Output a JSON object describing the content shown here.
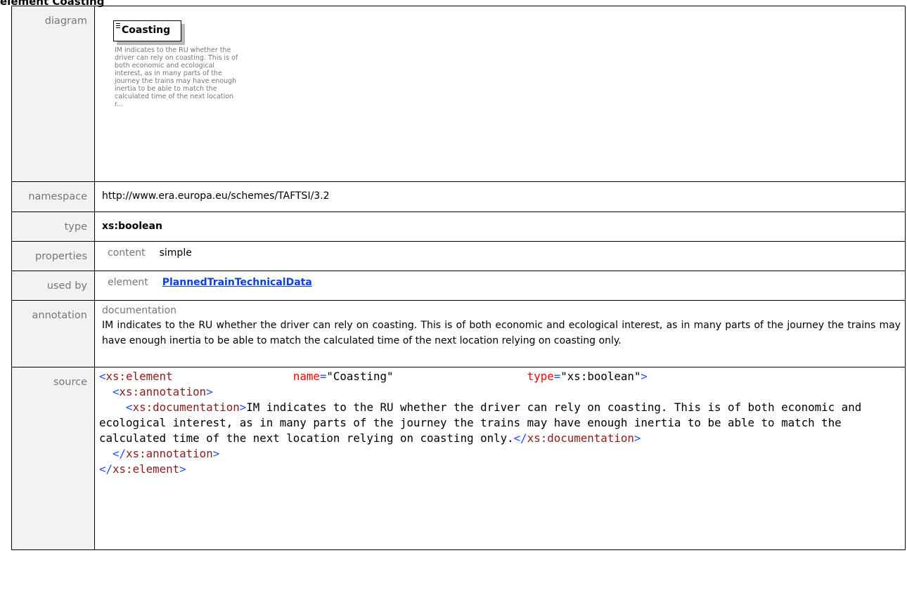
{
  "heading": "element Coasting",
  "labels": {
    "diagram": "diagram",
    "namespace": "namespace",
    "type": "type",
    "properties": "properties",
    "used_by": "used by",
    "annotation": "annotation",
    "source": "source"
  },
  "diagram": {
    "element_name": "Coasting",
    "doc_preview": "IM indicates to the RU whether the driver can rely on coasting. This is of both economic and ecological interest, as in many parts of the journey the trains may have enough inertia to be able to match the calculated time of the next location r..."
  },
  "namespace": "http://www.era.europa.eu/schemes/TAFTSI/3.2",
  "type": "xs:boolean",
  "properties": {
    "key": "content",
    "value": "simple"
  },
  "used_by": {
    "key": "element",
    "value": "PlannedTrainTechnicalData"
  },
  "annotation": {
    "label": "documentation",
    "text": "IM indicates to the RU whether the driver can rely on coasting. This is of both economic and ecological interest, as in many parts of the journey the trains may have enough inertia to be able to match the calculated time of the next location relying on coasting only."
  },
  "source": {
    "l1_open": "<",
    "l1_tag": "xs:element",
    "l1_attr1": "name",
    "l1_eq1": "=",
    "l1_val1": "\"Coasting\"",
    "l1_attr2": "type",
    "l1_eq2": "=",
    "l1_val2": "\"xs:boolean\"",
    "l1_close": ">",
    "l2_open": "<",
    "l2_tag": "xs:annotation",
    "l2_close": ">",
    "l3_open": "<",
    "l3_tag": "xs:documentation",
    "l3_close": ">",
    "doc_text": "IM indicates to the RU whether the driver can rely on coasting. This is of both economic and ecological interest, as in many parts of the journey the trains may have enough inertia to be able to match the calculated time of the next location relying on coasting only.",
    "l3_end_open": "</",
    "l3_end_tag": "xs:documentation",
    "l3_end_close": ">",
    "l4_open": "</",
    "l4_tag": "xs:annotation",
    "l4_close": ">",
    "l5_open": "</",
    "l5_tag": "xs:element",
    "l5_close": ">"
  }
}
